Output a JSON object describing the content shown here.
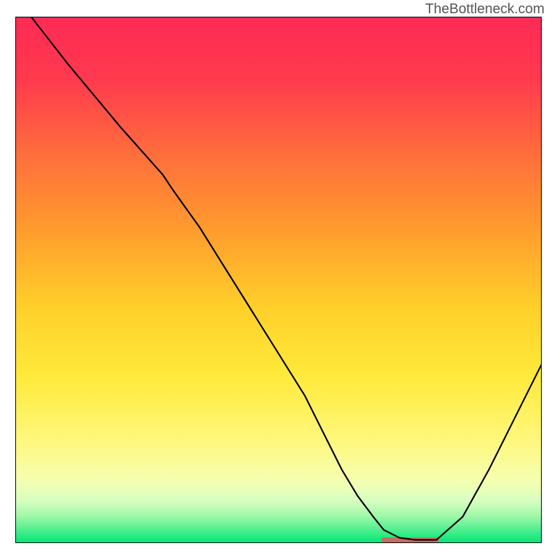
{
  "attribution": "TheBottleneck.com",
  "green_band_top_color": "#00e676",
  "chart_data": {
    "type": "line",
    "title": "",
    "xlabel": "",
    "ylabel": "",
    "xlim": [
      0,
      100
    ],
    "ylim": [
      0,
      100
    ],
    "series": [
      {
        "name": "curve",
        "x": [
          3,
          10,
          20,
          28,
          30,
          35,
          40,
          45,
          50,
          55,
          60,
          62,
          65,
          68,
          70,
          73,
          76,
          80,
          85,
          90,
          95,
          100
        ],
        "y": [
          100,
          91,
          79,
          70,
          67,
          60,
          52,
          44,
          36,
          28,
          18,
          14,
          9,
          5,
          2.5,
          1,
          0.6,
          0.6,
          5,
          14,
          24,
          34
        ]
      }
    ],
    "marker": {
      "name": "optimum-marker",
      "x_start": 70,
      "x_end": 80,
      "y": 0.6,
      "color": "#e05a5a"
    },
    "gradient_stops": [
      {
        "offset": 0,
        "color": "#ff2a55"
      },
      {
        "offset": 12,
        "color": "#ff3a4e"
      },
      {
        "offset": 25,
        "color": "#ff6a3d"
      },
      {
        "offset": 40,
        "color": "#ff9a2e"
      },
      {
        "offset": 55,
        "color": "#ffcf2a"
      },
      {
        "offset": 68,
        "color": "#ffe93a"
      },
      {
        "offset": 80,
        "color": "#fff77a"
      },
      {
        "offset": 88,
        "color": "#f6ffb0"
      },
      {
        "offset": 92,
        "color": "#d7ffc0"
      },
      {
        "offset": 95,
        "color": "#9cf7a8"
      },
      {
        "offset": 100,
        "color": "#00e676"
      }
    ]
  }
}
